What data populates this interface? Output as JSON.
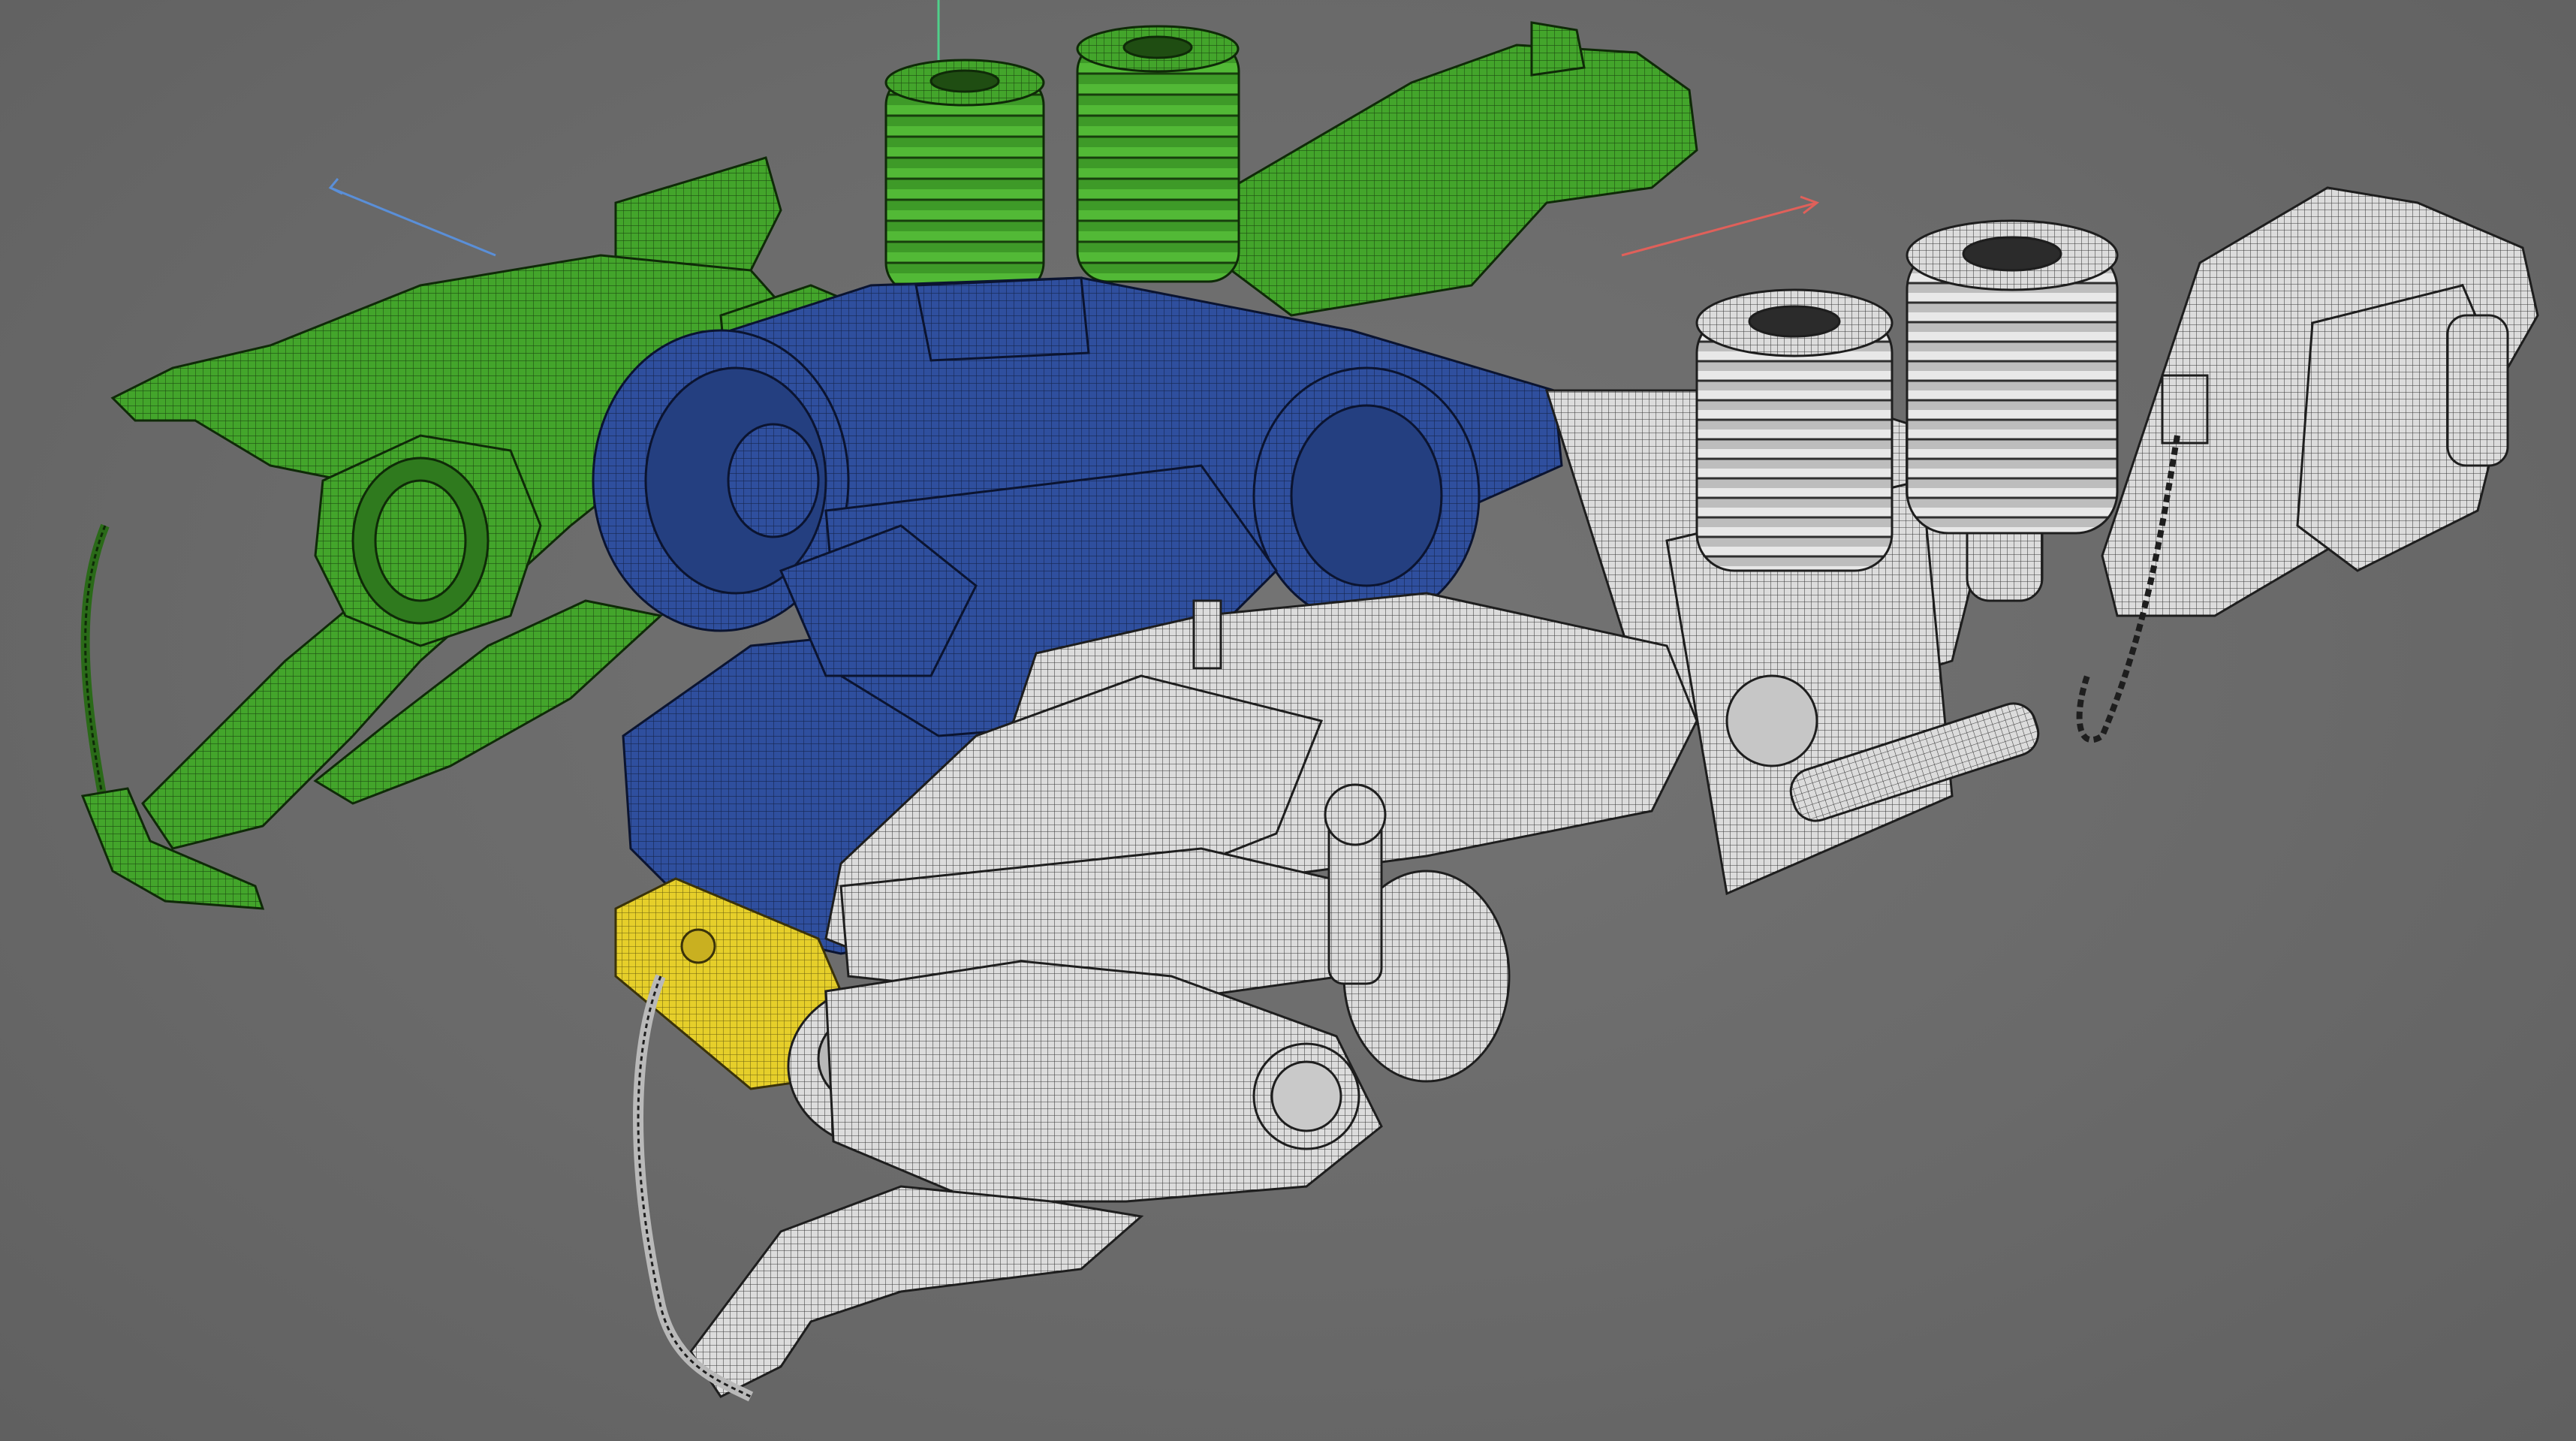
{
  "viewport": {
    "background": "#6b6b6b",
    "axes": {
      "x_color": "#e0605a",
      "y_color": "#4fd08a",
      "z_color": "#5a8fd8"
    },
    "parts": [
      {
        "name": "rear-bogie-frame",
        "color": "#43a52b"
      },
      {
        "name": "rear-coil-springs",
        "color": "#43a52b"
      },
      {
        "name": "traction-motor-gearbox",
        "color": "#2f4f9e"
      },
      {
        "name": "axle-box-bracket",
        "color": "#e6cf2a"
      },
      {
        "name": "front-bogie-frame",
        "color": "#d9d9d9"
      },
      {
        "name": "front-coil-springs",
        "color": "#d9d9d9"
      }
    ]
  }
}
